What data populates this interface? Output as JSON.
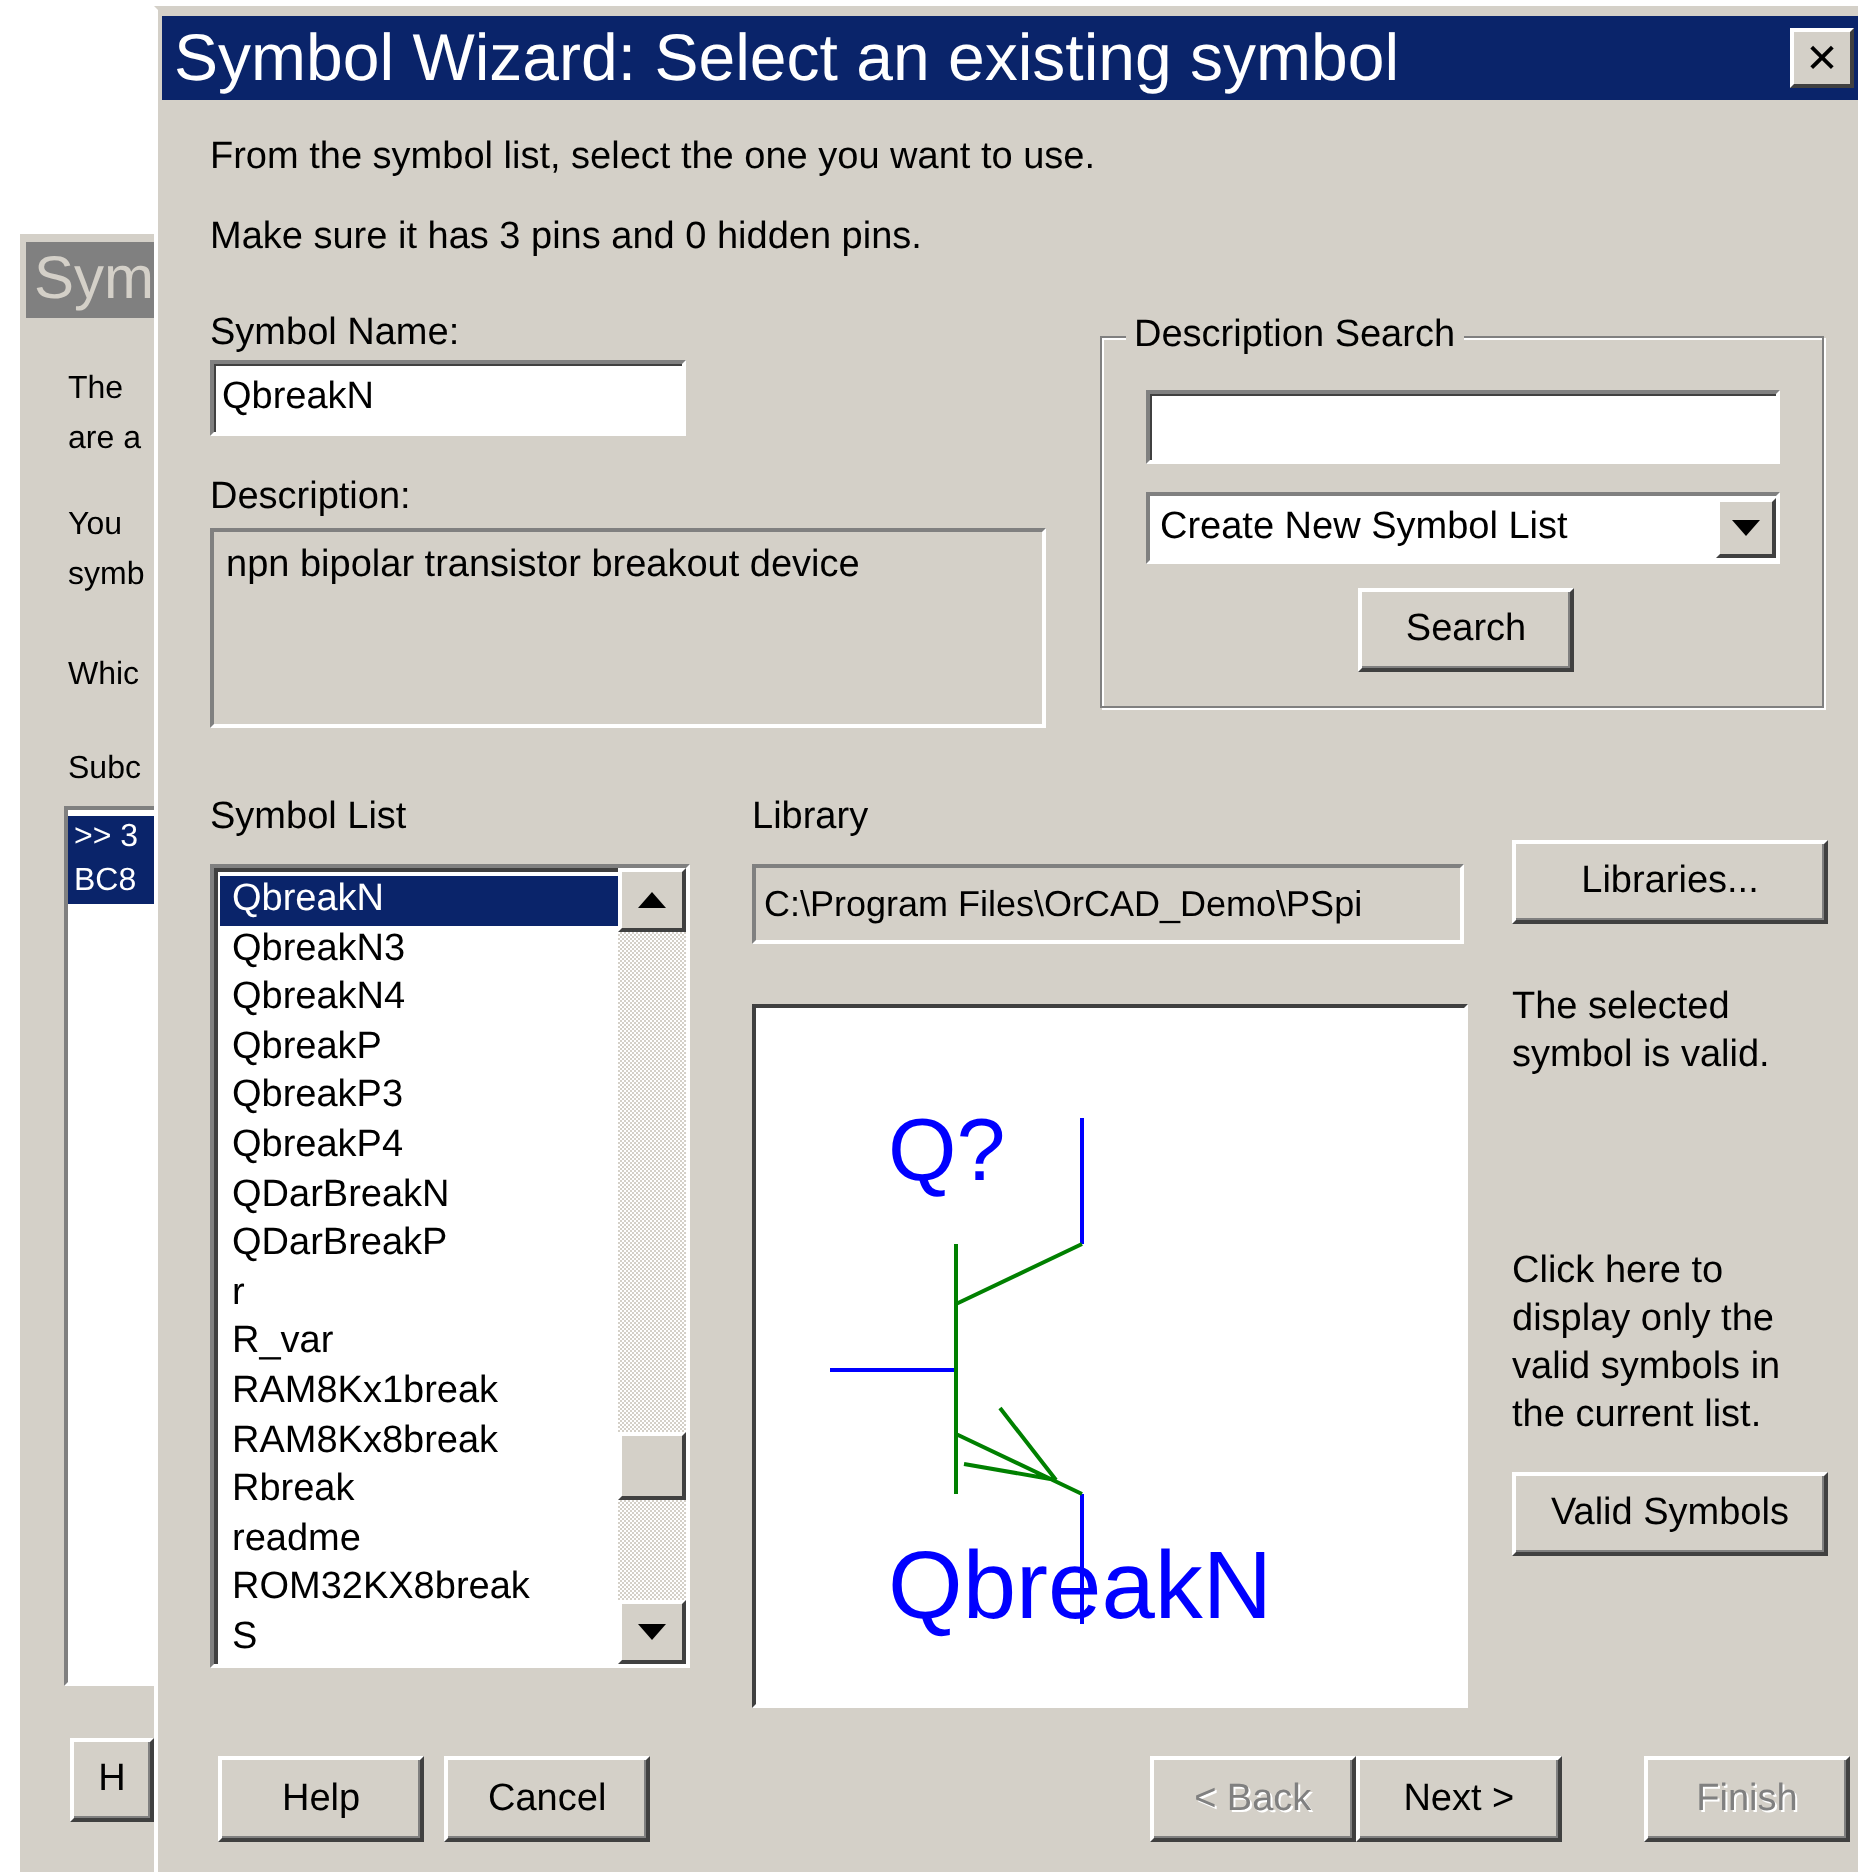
{
  "back_window": {
    "title": "Sym",
    "lines": [
      "The",
      "are a",
      "You",
      "symb",
      "Whic"
    ],
    "list_label": "Subc",
    "list_items": [
      {
        "label": ">> 3",
        "selected": true
      },
      {
        "label": "BC8",
        "selected": true
      }
    ],
    "button": {
      "label": "H"
    }
  },
  "window": {
    "title": "Symbol Wizard: Select an existing symbol",
    "close": "✕"
  },
  "instructions": [
    "From the symbol list, select the one you want to use.",
    "Make sure it has 3 pins and 0 hidden pins."
  ],
  "symbol_name": {
    "label": "Symbol Name:",
    "value": "QbreakN"
  },
  "description": {
    "label": "Description:",
    "value": "npn bipolar transistor breakout device"
  },
  "description_search": {
    "title": "Description Search",
    "dropdown": "Create New Symbol List",
    "button": {
      "label": "Search"
    }
  },
  "symbol_list": {
    "label": "Symbol List",
    "items": [
      {
        "label": "QbreakN",
        "selected": true
      },
      {
        "label": "QbreakN3",
        "selected": false
      },
      {
        "label": "QbreakN4",
        "selected": false
      },
      {
        "label": "QbreakP",
        "selected": false
      },
      {
        "label": "QbreakP3",
        "selected": false
      },
      {
        "label": "QbreakP4",
        "selected": false
      },
      {
        "label": "QDarBreakN",
        "selected": false
      },
      {
        "label": "QDarBreakP",
        "selected": false
      },
      {
        "label": "r",
        "selected": false
      },
      {
        "label": "R_var",
        "selected": false
      },
      {
        "label": "RAM8Kx1break",
        "selected": false
      },
      {
        "label": "RAM8Kx8break",
        "selected": false
      },
      {
        "label": "Rbreak",
        "selected": false
      },
      {
        "label": "readme",
        "selected": false
      },
      {
        "label": "ROM32KX8break",
        "selected": false
      },
      {
        "label": "S",
        "selected": false
      }
    ]
  },
  "library": {
    "label": "Library",
    "path": "C:\\Program Files\\OrCAD_Demo\\PSpi",
    "button": {
      "label": "Libraries..."
    }
  },
  "preview": {
    "reference": "Q?",
    "part_name": "QbreakN"
  },
  "validity_text": "The selected symbol is valid.",
  "valid_hint": "Click here to display only the valid symbols in the current list.",
  "valid_button": {
    "label": "Valid Symbols"
  },
  "buttons": [
    {
      "label": "Help",
      "disabled": false
    },
    {
      "label": "Cancel",
      "disabled": false
    },
    {
      "label": "< Back",
      "disabled": true
    },
    {
      "label": "Next >",
      "disabled": false
    },
    {
      "label": "Finish",
      "disabled": true
    }
  ]
}
